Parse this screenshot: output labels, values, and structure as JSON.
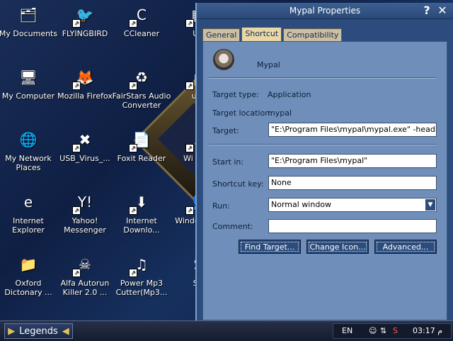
{
  "desktop": {
    "icons": [
      {
        "label": "My Documents",
        "glyph": "🗂",
        "icon": "my-documents-icon",
        "shortcut": false
      },
      {
        "label": "FLYINGBIRD",
        "glyph": "🐦",
        "icon": "bird-icon",
        "shortcut": true
      },
      {
        "label": "CCleaner",
        "glyph": "C",
        "icon": "ccleaner-icon",
        "shortcut": true
      },
      {
        "label": "Ult",
        "glyph": "▦",
        "icon": "app-icon",
        "shortcut": true
      },
      {
        "label": "My Computer",
        "glyph": "🖥",
        "icon": "my-computer-icon",
        "shortcut": false
      },
      {
        "label": "Mozilla Firefox",
        "glyph": "🦊",
        "icon": "firefox-icon",
        "shortcut": true
      },
      {
        "label": "FairStars Audio Converter",
        "glyph": "♻",
        "icon": "audio-converter-icon",
        "shortcut": true
      },
      {
        "label": "uTo",
        "glyph": "µ",
        "icon": "utorrent-icon",
        "shortcut": true
      },
      {
        "label": "My Network Places",
        "glyph": "🌐",
        "icon": "network-places-icon",
        "shortcut": false
      },
      {
        "label": "USB_Virus_...",
        "glyph": "✖",
        "icon": "usb-virus-icon",
        "shortcut": true
      },
      {
        "label": "Foxit Reader",
        "glyph": "📄",
        "icon": "foxit-reader-icon",
        "shortcut": true
      },
      {
        "label": "Wi Audi",
        "glyph": "♪",
        "icon": "audio-app-icon",
        "shortcut": true
      },
      {
        "label": "Internet Explorer",
        "glyph": "e",
        "icon": "internet-explorer-icon",
        "shortcut": false
      },
      {
        "label": "Yahoo! Messenger",
        "glyph": "Y!",
        "icon": "yahoo-messenger-icon",
        "shortcut": true
      },
      {
        "label": "Internet Downlo...",
        "glyph": "⬇",
        "icon": "download-manager-icon",
        "shortcut": true
      },
      {
        "label": "Windo Mess",
        "glyph": "👤",
        "icon": "windows-messenger-icon",
        "shortcut": true
      },
      {
        "label": "Oxford Dictonary ...",
        "glyph": "📁",
        "icon": "folder-icon",
        "shortcut": false
      },
      {
        "label": "Alfa Autorun Killer 2.0 ...",
        "glyph": "☠",
        "icon": "autorun-killer-icon",
        "shortcut": true
      },
      {
        "label": "Power Mp3 Cutter(Mp3...",
        "glyph": "♫",
        "icon": "mp3-cutter-icon",
        "shortcut": true
      },
      {
        "label": "SA",
        "glyph": "S",
        "icon": "app-icon",
        "shortcut": false
      }
    ]
  },
  "window": {
    "title": "Mypal Properties",
    "help": "?",
    "close": "✕",
    "tabs": [
      "General",
      "Shortcut",
      "Compatibility"
    ],
    "active_tab": "Shortcut",
    "app_name": "Mypal",
    "target_type_label": "Target type:",
    "target_type_value": "Application",
    "target_location_label": "Target location:",
    "target_location_value": "mypal",
    "target_label": "Target:",
    "target_value": "\"E:\\Program Files\\mypal\\mypal.exe\" -headless -no",
    "start_in_label": "Start in:",
    "start_in_value": "\"E:\\Program Files\\mypal\"",
    "shortcut_key_label": "Shortcut key:",
    "shortcut_key_value": "None",
    "run_label": "Run:",
    "run_value": "Normal window",
    "comment_label": "Comment:",
    "comment_value": "",
    "find_target_label": "Find Target...",
    "change_icon_label": "Change Icon...",
    "advanced_label": "Advanced..."
  },
  "taskbar": {
    "start_label": "Legends",
    "language": "EN",
    "clock": "03:17 م"
  }
}
